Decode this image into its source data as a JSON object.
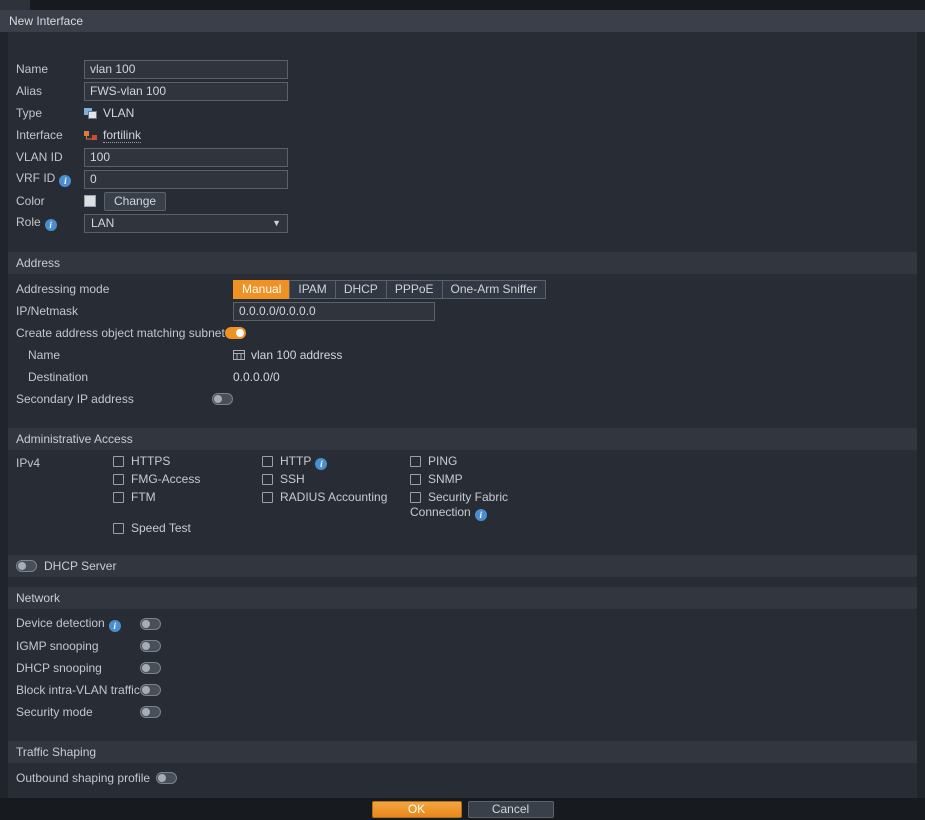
{
  "title": "New Interface",
  "colors": {
    "accent_orange": "#ef9123",
    "info_blue": "#4b8ed0",
    "panel": "#282d35",
    "header_bar": "#31363f"
  },
  "form": {
    "name": {
      "label": "Name",
      "value": "vlan 100"
    },
    "alias": {
      "label": "Alias",
      "value": "FWS-vlan 100"
    },
    "type": {
      "label": "Type",
      "value": "VLAN",
      "icon": "vlan-icon"
    },
    "interface": {
      "label": "Interface",
      "value": "fortilink",
      "icon": "fortilink-icon"
    },
    "vlan_id": {
      "label": "VLAN ID",
      "value": "100"
    },
    "vrf_id": {
      "label": "VRF ID",
      "value": "0",
      "info": true
    },
    "color": {
      "label": "Color",
      "button_label": "Change"
    },
    "role": {
      "label": "Role",
      "value": "LAN",
      "info": true
    }
  },
  "address": {
    "header": "Address",
    "addressing_mode": {
      "label": "Addressing mode",
      "options": [
        "Manual",
        "IPAM",
        "DHCP",
        "PPPoE",
        "One-Arm Sniffer"
      ],
      "selected": "Manual"
    },
    "ip_netmask": {
      "label": "IP/Netmask",
      "value": "0.0.0.0/0.0.0.0"
    },
    "create_address_object": {
      "label": "Create address object matching subnet",
      "enabled": true
    },
    "object_name": {
      "label": "Name",
      "value": "vlan 100 address",
      "icon": "address-object-icon"
    },
    "destination": {
      "label": "Destination",
      "value": "0.0.0.0/0"
    },
    "secondary_ip": {
      "label": "Secondary IP address",
      "enabled": false
    }
  },
  "admin_access": {
    "header": "Administrative Access",
    "ipv4_label": "IPv4",
    "items": [
      {
        "label": "HTTPS",
        "info": false,
        "checked": false
      },
      {
        "label": "HTTP",
        "info": true,
        "checked": false
      },
      {
        "label": "PING",
        "info": false,
        "checked": false
      },
      {
        "label": "FMG-Access",
        "info": false,
        "checked": false
      },
      {
        "label": "SSH",
        "info": false,
        "checked": false
      },
      {
        "label": "SNMP",
        "info": false,
        "checked": false
      },
      {
        "label": "FTM",
        "info": false,
        "checked": false
      },
      {
        "label": "RADIUS Accounting",
        "info": false,
        "checked": false
      },
      {
        "label": "Security Fabric Connection",
        "info": true,
        "checked": false
      },
      {
        "label": "Speed Test",
        "info": false,
        "checked": false
      }
    ]
  },
  "dhcp_server": {
    "label": "DHCP Server",
    "enabled": false
  },
  "network": {
    "header": "Network",
    "toggles": [
      {
        "label": "Device detection",
        "info": true,
        "enabled": false
      },
      {
        "label": "IGMP snooping",
        "info": false,
        "enabled": false
      },
      {
        "label": "DHCP snooping",
        "info": false,
        "enabled": false
      },
      {
        "label": "Block intra-VLAN traffic",
        "info": false,
        "enabled": false
      },
      {
        "label": "Security mode",
        "info": false,
        "enabled": false
      }
    ]
  },
  "traffic_shaping": {
    "header": "Traffic Shaping",
    "outbound": {
      "label": "Outbound shaping profile",
      "enabled": false
    }
  },
  "footer": {
    "ok_label": "OK",
    "cancel_label": "Cancel"
  }
}
